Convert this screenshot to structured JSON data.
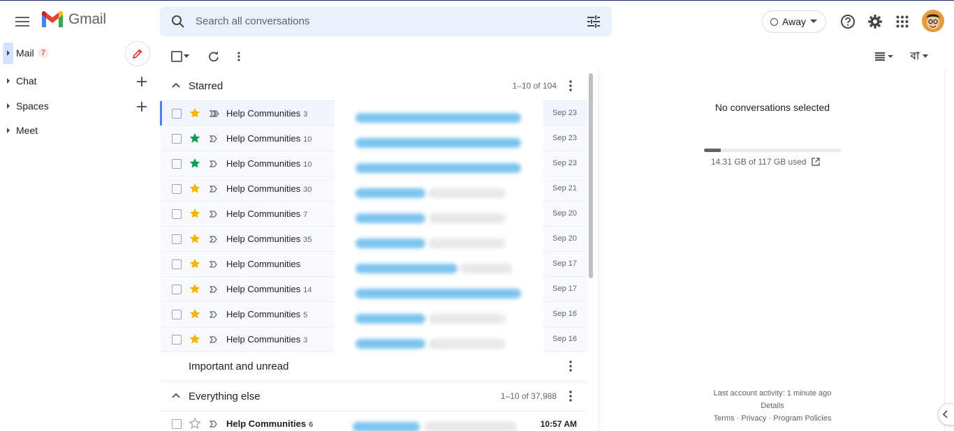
{
  "app": {
    "name": "Gmail"
  },
  "search": {
    "placeholder": "Search all conversations"
  },
  "status": {
    "label": "Away"
  },
  "nav": {
    "items": [
      {
        "label": "Mail",
        "badge": "7"
      },
      {
        "label": "Chat"
      },
      {
        "label": "Spaces"
      },
      {
        "label": "Meet"
      }
    ]
  },
  "sections": {
    "starred": {
      "title": "Starred",
      "count": "1–10 of 104"
    },
    "important": {
      "title": "Important and unread"
    },
    "everything": {
      "title": "Everything else",
      "count": "1–10 of 37,988"
    }
  },
  "starred_rows": [
    {
      "sender": "Help Communities",
      "count": "3",
      "date": "Sep 23",
      "star_color": "#f4b400"
    },
    {
      "sender": "Help Communities",
      "count": "10",
      "date": "Sep 23",
      "star_color": "#0f9d58"
    },
    {
      "sender": "Help Communities",
      "count": "10",
      "date": "Sep 23",
      "star_color": "#0f9d58"
    },
    {
      "sender": "Help Communities",
      "count": "30",
      "date": "Sep 21",
      "star_color": "#f4b400"
    },
    {
      "sender": "Help Communities",
      "count": "7",
      "date": "Sep 20",
      "star_color": "#f4b400"
    },
    {
      "sender": "Help Communities",
      "count": "35",
      "date": "Sep 20",
      "star_color": "#f4b400"
    },
    {
      "sender": "Help Communities",
      "count": "",
      "date": "Sep 17",
      "star_color": "#f4b400"
    },
    {
      "sender": "Help Communities",
      "count": "14",
      "date": "Sep 17",
      "star_color": "#f4b400"
    },
    {
      "sender": "Help Communities",
      "count": "5",
      "date": "Sep 16",
      "star_color": "#f4b400"
    },
    {
      "sender": "Help Communities",
      "count": "3",
      "date": "Sep 16",
      "star_color": "#f4b400"
    }
  ],
  "everything_rows": [
    {
      "sender": "Help Communities",
      "count": "6",
      "date": "10:57 AM"
    }
  ],
  "reading_pane": {
    "empty_text": "No conversations selected",
    "storage": "14.31 GB of 117 GB used",
    "storage_fraction": 0.122,
    "last_activity": "Last account activity: 1 minute ago",
    "details": "Details",
    "terms": "Terms",
    "privacy": "Privacy",
    "program_policies": "Program Policies",
    "separator": "·"
  },
  "colors": {
    "accent": "#0b57d0",
    "search_bg": "#eaf1fb",
    "unread_badge": "#c5221f"
  }
}
